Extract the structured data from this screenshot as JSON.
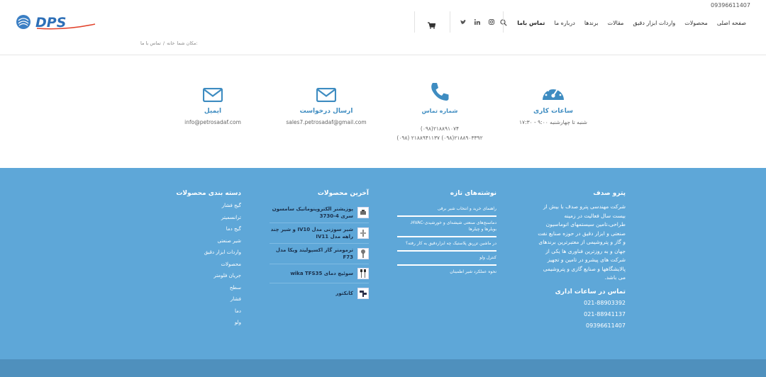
{
  "topbar": {
    "phone": "09396611407"
  },
  "brand": {
    "logo_text": "DPS"
  },
  "nav": {
    "items": [
      "صفحه اصلی",
      "محصولات",
      "واردات ابزار دقیق",
      "مقالات",
      "برندها",
      "درباره ما",
      "تماس باما"
    ],
    "active_index": 6
  },
  "breadcrumb": {
    "prefix": "مکان شما:",
    "home": "خانه",
    "separator": "/",
    "current": "تماس با ما"
  },
  "contact": {
    "hours": {
      "title": "ساعات کاری",
      "text": "شنبه تا چهارشنبه ۹:۰۰ - ۱۷:۳۰"
    },
    "phone": {
      "title": "شماره تماس",
      "line1": "(۰۹۸)۲۱۸۸۹۱۰۷۴",
      "line2": "(۰۹۸) ۲۱۸۸۹۴۱۱۳۷ (۰۹۸)۲۱۸۸۹۰۳۳۹۲"
    },
    "request": {
      "title": "ارسال درخواست",
      "email": "sales7.petrosadaf@gmail.com"
    },
    "email": {
      "title": "ایمیل",
      "email": "info@petrosadaf.com"
    }
  },
  "footer": {
    "about": {
      "title": "پترو صدف",
      "text": "شرکت مهندسی پترو صدف با بیش از بیست سال فعالیت در زمینه طراحی،تامین سیستمهای اتوماسیون صنعتی و ابزار دقیق در حوزه صنایع نفت و گاز و پتروشیمی از معتبرترین برندهای جهان و به روزترین فناوری ها یکی از شرکت های پیشرو در تامین و تجهیز پالایشگاهها و صنایع گازی و پتروشیمی می باشد.",
      "hours_title": "تماس در ساعات اداری",
      "phones": [
        "021-88903392",
        "021-88941137",
        "09396611407"
      ]
    },
    "posts": {
      "title": "نوشته‌های تازه",
      "items": [
        "راهنمای خرید و انتخاب شیر برقی",
        "دماسنج‌های صنعتی شیشه‌ای و خورشیدی-HVAC، بویلرها و چیلرها",
        "در ماشین تزریق پلاستیک چه ابزاردقیق به کار رفته؟",
        "کنترل ولو",
        "نحوه عملکرد شیر اطمینان"
      ]
    },
    "products": {
      "title": "آخرین محصولات",
      "items": [
        "پوزیشنر الکتروپنوماتیک سامسون سری 4-3730",
        "شیر سوزنی مدل IV10 و شیر چند راهه مدل IV11",
        "ترمومتر گاز اکسپولیتد ویکا مدل F73",
        "سوئیچ دمای wika TFS35",
        "کانکتور"
      ]
    },
    "categories": {
      "title": "دسته بندی محصولات",
      "items": [
        "گیج فشار",
        "ترانسمیتر",
        "گیج دما",
        "شیر صنعتی",
        "واردات ابزار دقیق",
        "محصولات",
        "جریان فلومتر",
        "سطح",
        "فشار",
        "دما",
        "ولو"
      ]
    }
  },
  "colors": {
    "accent": "#3e8cc1",
    "footer_bg": "#5ea7d8",
    "footer_bottom": "#4f90bd"
  },
  "icons": [
    "search-icon",
    "instagram-icon",
    "linkedin-icon",
    "twitter-icon",
    "cart-icon",
    "speedometer-icon",
    "phone-icon",
    "envelope-icon"
  ]
}
